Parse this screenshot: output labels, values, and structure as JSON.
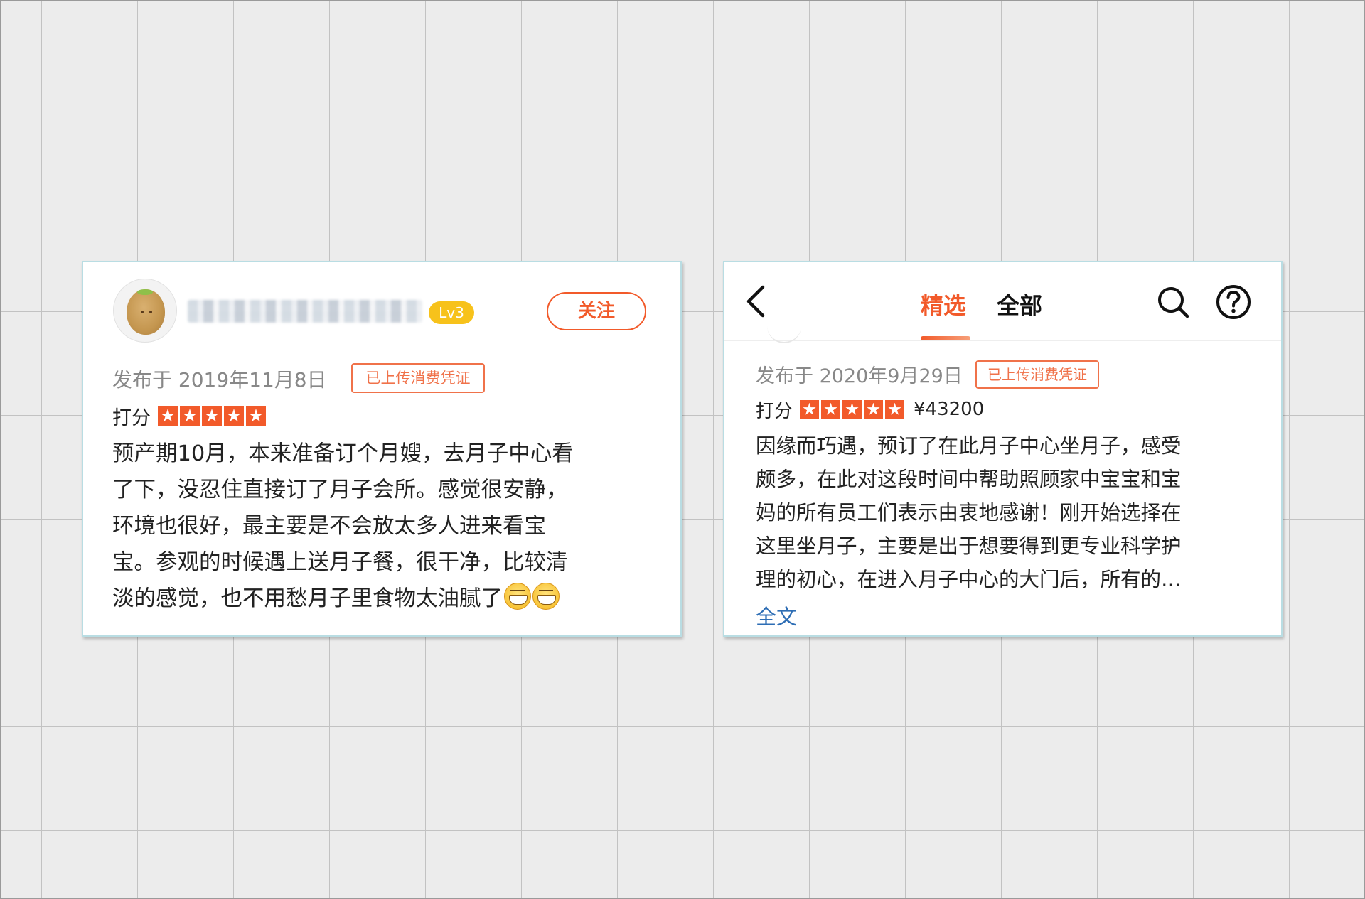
{
  "card1": {
    "level_badge": "Lv3",
    "follow_label": "关注",
    "date": "发布于 2019年11月8日",
    "voucher": "已上传消费凭证",
    "score_label": "打分",
    "rating": 5,
    "rating_max": 5,
    "review_lines": [
      "预产期10月，本来准备订个月嫂，去月子中心看",
      "了下，没忍住直接订了月子会所。感觉很安静，",
      "环境也很好，最主要是不会放太多人进来看宝",
      "宝。参观的时候遇上送月子餐，很干净，比较清",
      "淡的感觉，也不用愁月子里食物太油腻了"
    ],
    "trailing_emoji_count": 2
  },
  "card2": {
    "tabs": [
      "精选",
      "全部"
    ],
    "active_tab": "精选",
    "date": "发布于 2020年9月29日",
    "voucher": "已上传消费凭证",
    "score_label": "打分",
    "rating": 5,
    "rating_max": 5,
    "price": "¥43200",
    "review_lines": [
      "因缘而巧遇，预订了在此月子中心坐月子，感受",
      "颇多，在此对这段时间中帮助照顾家中宝宝和宝",
      "妈的所有员工们表示由衷地感谢！刚开始选择在",
      "这里坐月子，主要是出于想要得到更专业科学护",
      "理的初心，在进入月子中心的大门后，所有的…"
    ],
    "full_text_link": "全文"
  },
  "colors": {
    "accent": "#f25a2a",
    "level_badge": "#f7c21b",
    "link": "#2e6eb5",
    "card_border": "#b9dde3"
  },
  "icons": [
    "avatar-kiwi",
    "back-icon",
    "search-icon",
    "help-icon",
    "star-icon",
    "grin-emoji"
  ]
}
